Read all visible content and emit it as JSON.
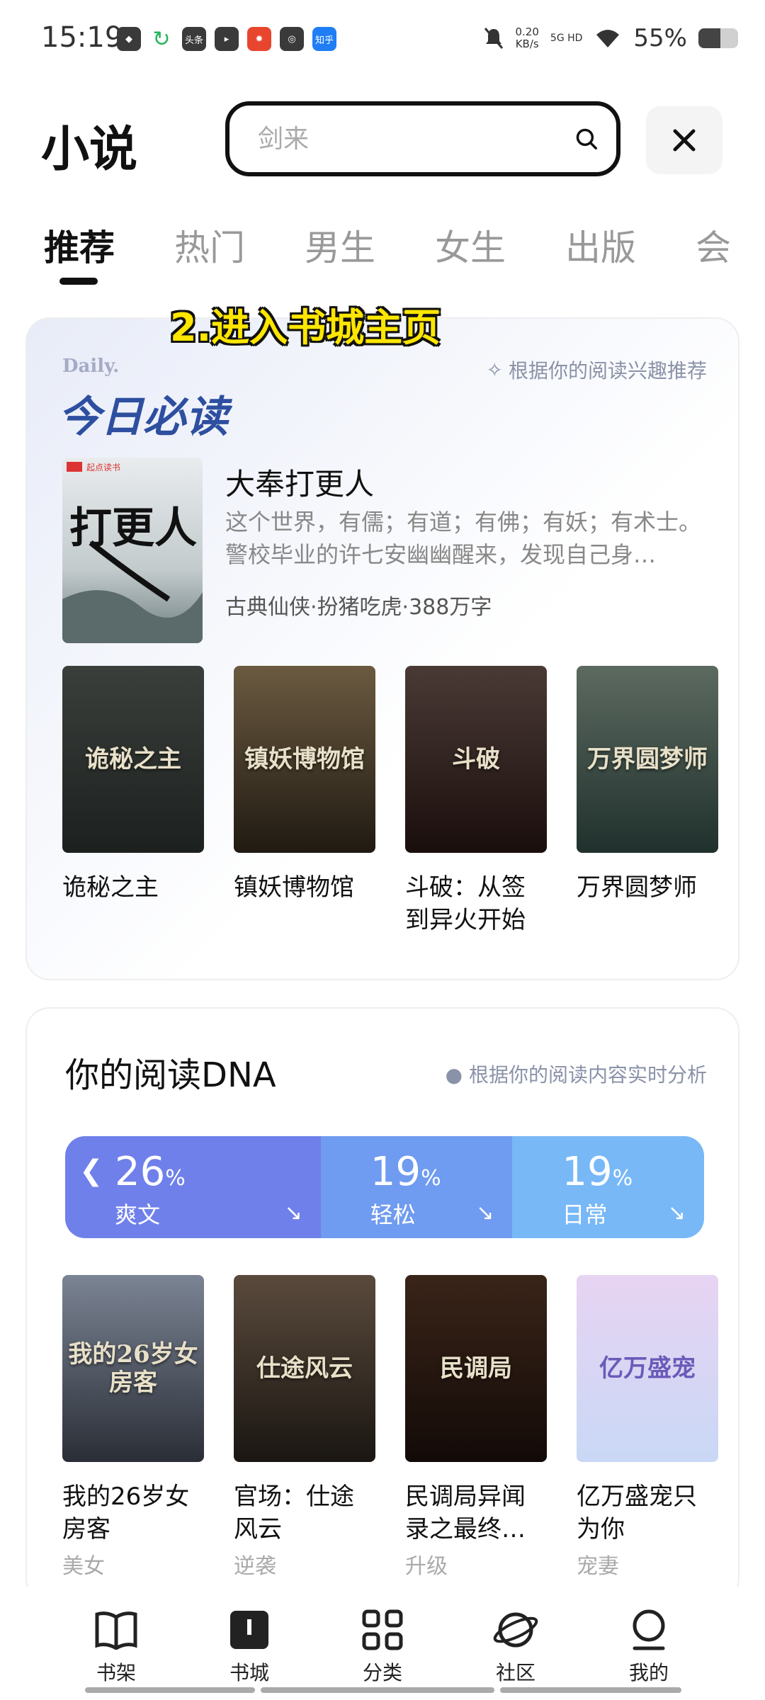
{
  "status_bar": {
    "time": "15:19",
    "notif_apps": [
      {
        "name": "gallery-app-icon",
        "label": "◆",
        "style": ""
      },
      {
        "name": "refresh-app-icon",
        "label": "↻",
        "style": "green"
      },
      {
        "name": "toutiao-app-icon",
        "label": "头条",
        "style": ""
      },
      {
        "name": "message-app-icon",
        "label": "▸",
        "style": ""
      },
      {
        "name": "fireworks-app-icon",
        "label": "✹",
        "style": "red"
      },
      {
        "name": "qq-app-icon",
        "label": "◎",
        "style": ""
      },
      {
        "name": "zhihu-app-icon",
        "label": "知乎",
        "style": "blue"
      }
    ],
    "net_speed_value": "0.20",
    "net_speed_unit": "KB/s",
    "network": "5G HD",
    "battery_percent": "55%",
    "battery_level": 0.55
  },
  "header": {
    "title": "小说",
    "search_placeholder": "剑来"
  },
  "tabs": [
    "推荐",
    "热门",
    "男生",
    "女生",
    "出版",
    "会"
  ],
  "overlay_caption": "2.进入书城主页",
  "daily": {
    "en_label": "Daily.",
    "title": "今日必读",
    "hint": "根据你的阅读兴趣推荐",
    "featured": {
      "title": "大奉打更人",
      "cover_text": "打更人",
      "description": "这个世界，有儒；有道；有佛；有妖；有术士。警校毕业的许七安幽幽醒来，发现自己身…",
      "tags": "古典仙侠·扮猪吃虎·388万字"
    },
    "books": [
      {
        "title": "诡秘之主",
        "cover_text": "诡秘之主",
        "colors": [
          "#3a3f3c",
          "#1c201e"
        ]
      },
      {
        "title": "镇妖博物馆",
        "cover_text": "镇妖博物馆",
        "colors": [
          "#6b5a40",
          "#201a12"
        ]
      },
      {
        "title": "斗破：从签到异火开始",
        "cover_text": "斗破",
        "colors": [
          "#4a3a36",
          "#1a0e0c"
        ]
      },
      {
        "title": "万界圆梦师",
        "cover_text": "万界圆梦师",
        "colors": [
          "#5c6a60",
          "#20302c"
        ]
      }
    ]
  },
  "dna": {
    "title": "你的阅读DNA",
    "hint": "根据你的阅读内容实时分析",
    "segments": [
      {
        "percent": "26",
        "label": "爽文",
        "color": "#6f80ea",
        "share": 0.4
      },
      {
        "percent": "19",
        "label": "轻松",
        "color": "#6f9bf0",
        "share": 0.3
      },
      {
        "percent": "19",
        "label": "日常",
        "color": "#78b8f7",
        "share": 0.3
      }
    ],
    "percent_sign": "%",
    "books": [
      {
        "title": "我的26岁女房客",
        "tag": "美女",
        "cover_text": "我的26岁女房客",
        "colors": [
          "#7b8494",
          "#2a2e36"
        ]
      },
      {
        "title": "官场：仕途风云",
        "tag": "逆袭",
        "cover_text": "仕途风云",
        "colors": [
          "#5a4a3c",
          "#1a1612"
        ]
      },
      {
        "title": "民调局异闻录之最终…",
        "tag": "升级",
        "cover_text": "民调局",
        "colors": [
          "#3a2418",
          "#120a08"
        ]
      },
      {
        "title": "亿万盛宠只为你",
        "tag": "宠妻",
        "cover_text": "亿万盛宠",
        "colors": [
          "#e7d4f2",
          "#c9d8f6"
        ]
      }
    ]
  },
  "bottom_nav": [
    {
      "label": "书架",
      "icon": "bookshelf-icon"
    },
    {
      "label": "书城",
      "icon": "bookstore-icon"
    },
    {
      "label": "分类",
      "icon": "category-icon"
    },
    {
      "label": "社区",
      "icon": "community-icon"
    },
    {
      "label": "我的",
      "icon": "profile-icon"
    }
  ]
}
